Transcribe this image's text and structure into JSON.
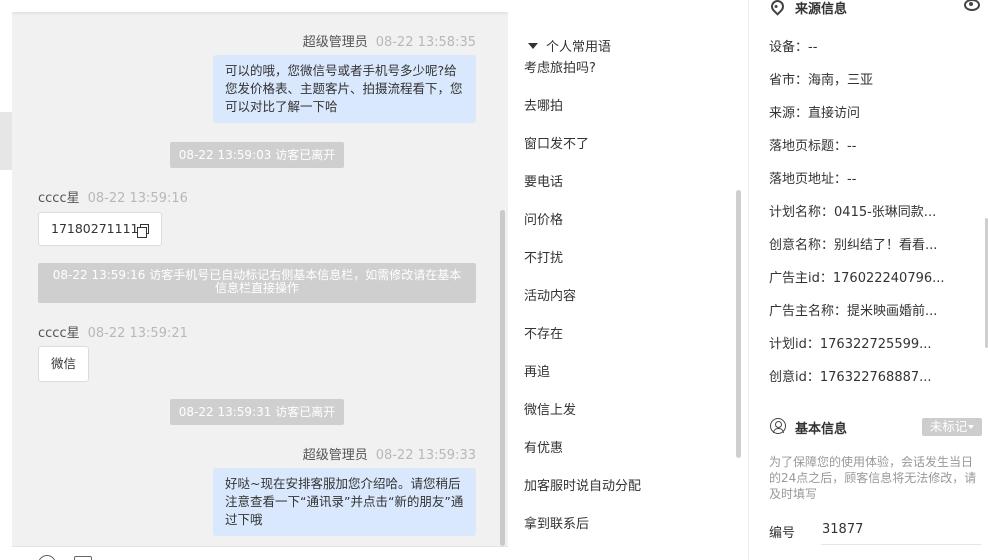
{
  "chat": {
    "messages": [
      {
        "sender": "超级管理员",
        "time": "08-22 13:58:35",
        "text": "可以的哦，您微信号或者手机号多少呢?给您发价格表、主题客片、拍摄流程看下，您可以对比了解一下哈"
      },
      {
        "system": "08-22 13:59:03 访客已离开"
      },
      {
        "sender": "cccc星",
        "time": "08-22 13:59:16",
        "text": "17180271111"
      },
      {
        "system": "08-22 13:59:16 访客手机号已自动标记右侧基本信息栏，如需修改请在基本信息栏直接操作"
      },
      {
        "sender": "cccc星",
        "time": "08-22 13:59:21",
        "text": "微信"
      },
      {
        "system": "08-22 13:59:31 访客已离开"
      },
      {
        "sender": "超级管理员",
        "time": "08-22 13:59:33",
        "text": "好哒~现在安排客服加您介绍哈。请您稍后注意查看一下“通讯录”并点击“新的朋友”通过下哦"
      }
    ]
  },
  "phrases": {
    "header": "个人常用语",
    "items": [
      "考虑旅拍吗?",
      "去哪拍",
      "窗口发不了",
      "要电话",
      "问价格",
      "不打扰",
      "活动内容",
      "不存在",
      "再追",
      "微信上发",
      "有优惠",
      "加客服时说自动分配",
      "拿到联系后"
    ]
  },
  "source": {
    "title": "来源信息",
    "fields": [
      {
        "label": "设备",
        "value": "--"
      },
      {
        "label": "省市",
        "value": "海南，三亚"
      },
      {
        "label": "来源",
        "value": "直接访问"
      },
      {
        "label": "落地页标题",
        "value": "--"
      },
      {
        "label": "落地页地址",
        "value": "--"
      },
      {
        "label": "计划名称",
        "value": "0415-张琳同款..."
      },
      {
        "label": "创意名称",
        "value": "别纠结了！看看..."
      },
      {
        "label": "广告主id",
        "value": "176022240796..."
      },
      {
        "label": "广告主名称",
        "value": "提米映画婚前..."
      },
      {
        "label": "计划id",
        "value": "176322725599..."
      },
      {
        "label": "创意id",
        "value": "176322768887..."
      }
    ]
  },
  "basic": {
    "title": "基本信息",
    "tag": "未标记",
    "notice": "为了保障您的使用体验，会话发生当日的24点之后，顾客信息将无法修改，请及时填写",
    "number_label": "编号",
    "number_value": "31877"
  }
}
